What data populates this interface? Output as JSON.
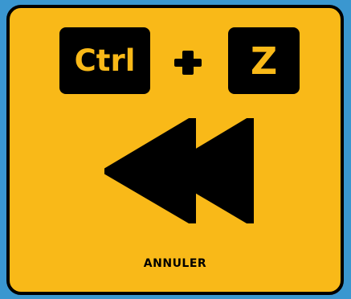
{
  "card": {
    "key_ctrl": "Ctrl",
    "key_z": "Z",
    "caption": "ANNULER"
  },
  "icons": {
    "plus": "plus-icon",
    "rewind": "rewind-icon"
  },
  "colors": {
    "background": "#3a97d0",
    "card": "#f9b918",
    "ink": "#000000"
  }
}
